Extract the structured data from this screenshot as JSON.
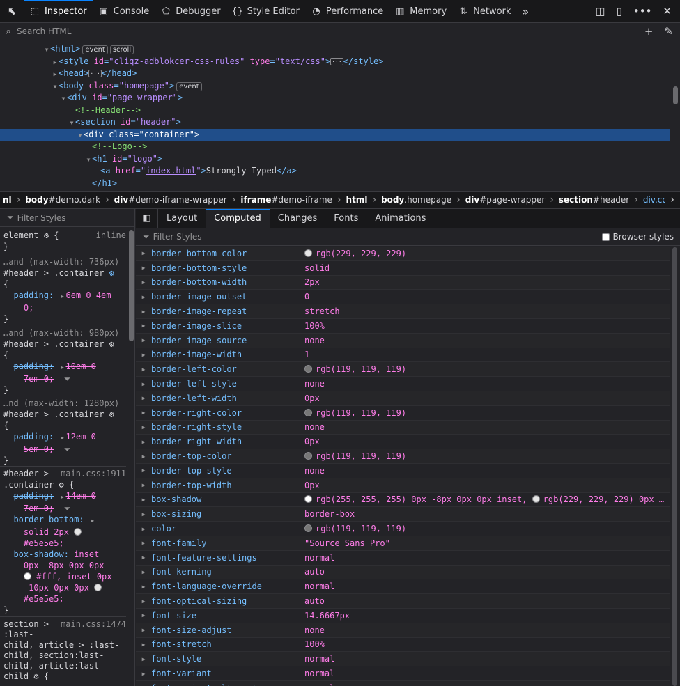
{
  "toolbar": {
    "tabs": [
      {
        "label": "Inspector",
        "icon": "inspector-icon",
        "glyph": "⬚"
      },
      {
        "label": "Console",
        "icon": "console-icon",
        "glyph": "▣"
      },
      {
        "label": "Debugger",
        "icon": "debugger-icon",
        "glyph": "⬠"
      },
      {
        "label": "Style Editor",
        "icon": "style-editor-icon",
        "glyph": "{}"
      },
      {
        "label": "Performance",
        "icon": "performance-icon",
        "glyph": "◔"
      },
      {
        "label": "Memory",
        "icon": "memory-icon",
        "glyph": "▥"
      },
      {
        "label": "Network",
        "icon": "network-icon",
        "glyph": "⇅"
      }
    ],
    "overflow": "»"
  },
  "search": {
    "placeholder": "Search HTML"
  },
  "markup": {
    "lines": [
      {
        "html": "<span class=\"tw\">▼</span><span class=\"tag\">&lt;html&gt;</span><span class=\"badge\">event</span><span class=\"badge\">scroll</span>",
        "indent": 62
      },
      {
        "html": "<span class=\"tw\">▶</span><span class=\"tag\">&lt;style </span><span class=\"attr\">id</span><span class=\"tag\">=</span><span class=\"val\">\"cliqz-adblokcer-css-rules\"</span> <span class=\"attr\">type</span><span class=\"tag\">=</span><span class=\"val\">\"text/css\"</span><span class=\"tag\">&gt;</span><span class=\"ell\">···</span><span class=\"tag\">&lt;/style&gt;</span>",
        "indent": 74
      },
      {
        "html": "<span class=\"tw\">▶</span><span class=\"tag\">&lt;head&gt;</span><span class=\"ell\">···</span><span class=\"tag\">&lt;/head&gt;</span>",
        "indent": 74
      },
      {
        "html": "<span class=\"tw\">▼</span><span class=\"tag\">&lt;body </span><span class=\"attr\">class</span><span class=\"tag\">=</span><span class=\"val\">\"homepage\"</span><span class=\"tag\">&gt;</span><span class=\"badge\">event</span>",
        "indent": 74
      },
      {
        "html": "<span class=\"tw\">▼</span><span class=\"tag\">&lt;div </span><span class=\"attr\">id</span><span class=\"tag\">=</span><span class=\"val\">\"page-wrapper\"</span><span class=\"tag\">&gt;</span>",
        "indent": 86
      },
      {
        "html": "<span class=\"tw\"></span><span class=\"cmt\">&lt;!--Header--&gt;</span>",
        "indent": 98
      },
      {
        "html": "<span class=\"tw\">▼</span><span class=\"tag\">&lt;section </span><span class=\"attr\">id</span><span class=\"tag\">=</span><span class=\"val\">\"header\"</span><span class=\"tag\">&gt;</span>",
        "indent": 98
      },
      {
        "html": "<span class=\"tw\">▼</span><span class=\"tag\">&lt;div </span><span class=\"attr\">class</span><span class=\"tag\">=</span><span class=\"val\">\"container\"</span><span class=\"tag\">&gt;</span>",
        "indent": 110,
        "selected": true
      },
      {
        "html": "<span class=\"tw\"></span><span class=\"cmt\">&lt;!--Logo--&gt;</span>",
        "indent": 122
      },
      {
        "html": "<span class=\"tw\">▼</span><span class=\"tag\">&lt;h1 </span><span class=\"attr\">id</span><span class=\"tag\">=</span><span class=\"val\">\"logo\"</span><span class=\"tag\">&gt;</span>",
        "indent": 122
      },
      {
        "html": "<span class=\"tw\"></span><span class=\"tag\">&lt;a </span><span class=\"attr\">href</span><span class=\"tag\">=</span><span class=\"val\">\"</span><span class=\"link\">index.html</span><span class=\"val\">\"</span><span class=\"tag\">&gt;</span><span class=\"txt\">Strongly Typed</span><span class=\"tag\">&lt;/a&gt;</span>",
        "indent": 134
      },
      {
        "html": "<span class=\"tw\"></span><span class=\"tag\">&lt;/h1&gt;</span>",
        "indent": 122
      }
    ]
  },
  "breadcrumbs": [
    {
      "tag": "nl",
      "rest": ""
    },
    {
      "tag": "body",
      "rest": "#demo.dark"
    },
    {
      "tag": "div",
      "rest": "#demo-iframe-wrapper"
    },
    {
      "tag": "iframe",
      "rest": "#demo-iframe"
    },
    {
      "tag": "html",
      "rest": ""
    },
    {
      "tag": "body",
      "rest": ".homepage"
    },
    {
      "tag": "div",
      "rest": "#page-wrapper"
    },
    {
      "tag": "section",
      "rest": "#header"
    },
    {
      "tag": "div",
      "rest": ".container",
      "current": true
    }
  ],
  "rules": {
    "filter_placeholder": "Filter Styles",
    "element_label": "element",
    "inline_label": "inline",
    "blocks": [
      {
        "src": "…and (max-width: 736px)"
      },
      {
        "src": "…and (max-width: 980px)"
      },
      {
        "src": "…nd (max-width: 1280px)"
      },
      {
        "src": "main.css:1911"
      },
      {
        "src": "main.css:1474"
      }
    ],
    "selector_header_container": "#header > .container",
    "padding_prop": "padding:",
    "values": {
      "p736a": "6em 0 4em",
      "p736b": "0;",
      "p980a": "10em 0",
      "p980b": "7em 0;",
      "p1280a": "12em 0",
      "p1280b": "5em 0;",
      "pmainA": "14em 0",
      "pmainB": "7em 0;",
      "bb_prop": "border-bottom:",
      "bb_val1": "solid 2px",
      "bb_val2": "#e5e5e5;",
      "bs_prop": "box-shadow:",
      "bs_val1": "inset",
      "bs_val2": "0px -8px 0px 0px",
      "bs_val3": "#fff, inset 0px",
      "bs_val4": "-10px 0px 0px",
      "bs_val5": "#e5e5e5;"
    },
    "main_selector_a": "#header >",
    "main_selector_b": ".container",
    "last_sel_1": "section >",
    "last_sel_2": ":last-",
    "last_sel_3": "child, article > :last-",
    "last_sel_4": "child, section:last-",
    "last_sel_5": "child, article:last-",
    "last_sel_6": "child"
  },
  "sidetabs": [
    "Layout",
    "Computed",
    "Changes",
    "Fonts",
    "Animations"
  ],
  "computed": {
    "filter_placeholder": "Filter Styles",
    "browser_styles": "Browser styles",
    "props": [
      {
        "name": "border-bottom-color",
        "value": "rgb(229, 229, 229)",
        "swatch": "#e5e5e5"
      },
      {
        "name": "border-bottom-style",
        "value": "solid"
      },
      {
        "name": "border-bottom-width",
        "value": "2px"
      },
      {
        "name": "border-image-outset",
        "value": "0"
      },
      {
        "name": "border-image-repeat",
        "value": "stretch"
      },
      {
        "name": "border-image-slice",
        "value": "100%"
      },
      {
        "name": "border-image-source",
        "value": "none"
      },
      {
        "name": "border-image-width",
        "value": "1"
      },
      {
        "name": "border-left-color",
        "value": "rgb(119, 119, 119)",
        "swatch": "#777777"
      },
      {
        "name": "border-left-style",
        "value": "none"
      },
      {
        "name": "border-left-width",
        "value": "0px"
      },
      {
        "name": "border-right-color",
        "value": "rgb(119, 119, 119)",
        "swatch": "#777777"
      },
      {
        "name": "border-right-style",
        "value": "none"
      },
      {
        "name": "border-right-width",
        "value": "0px"
      },
      {
        "name": "border-top-color",
        "value": "rgb(119, 119, 119)",
        "swatch": "#777777"
      },
      {
        "name": "border-top-style",
        "value": "none"
      },
      {
        "name": "border-top-width",
        "value": "0px"
      },
      {
        "name": "box-shadow",
        "value": "rgb(255, 255, 255) 0px -8px 0px 0px inset,",
        "swatch": "#ffffff",
        "value2": "rgb(229, 229, 229) 0px …",
        "swatch2": "#e5e5e5"
      },
      {
        "name": "box-sizing",
        "value": "border-box"
      },
      {
        "name": "color",
        "value": "rgb(119, 119, 119)",
        "swatch": "#777777"
      },
      {
        "name": "font-family",
        "value": "\"Source Sans Pro\""
      },
      {
        "name": "font-feature-settings",
        "value": "normal"
      },
      {
        "name": "font-kerning",
        "value": "auto"
      },
      {
        "name": "font-language-override",
        "value": "normal"
      },
      {
        "name": "font-optical-sizing",
        "value": "auto"
      },
      {
        "name": "font-size",
        "value": "14.6667px"
      },
      {
        "name": "font-size-adjust",
        "value": "none"
      },
      {
        "name": "font-stretch",
        "value": "100%"
      },
      {
        "name": "font-style",
        "value": "normal"
      },
      {
        "name": "font-variant",
        "value": "normal"
      },
      {
        "name": "font-variant-alternates",
        "value": "normal"
      }
    ]
  },
  "colors": {
    "accent": "#0a84ff",
    "selection": "#204e8a",
    "tag": "#75bfff",
    "attr": "#ff7de9",
    "value": "#b98eff",
    "comment": "#86de74"
  }
}
